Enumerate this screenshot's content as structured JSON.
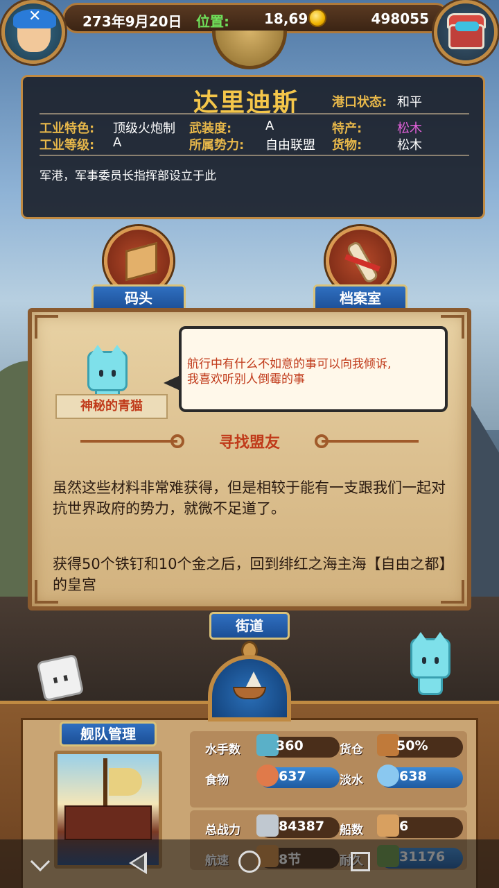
{
  "topbar": {
    "date": "273年9月20日",
    "position_label": "位置:",
    "position_value": "18,69",
    "gold": "498055"
  },
  "port": {
    "name": "达里迪斯",
    "status_label": "港口状态:",
    "status_value": "和平",
    "industry_feature_label": "工业特色:",
    "industry_feature_value": "顶级火炮制",
    "armament_label": "武装度:",
    "armament_value": "A",
    "specialty_label": "特产:",
    "specialty_value": "松木",
    "industry_level_label": "工业等级:",
    "industry_level_value": "A",
    "faction_label": "所属势力:",
    "faction_value": "自由联盟",
    "cargo_label": "货物:",
    "cargo_value": "松木",
    "description": "军港，军事委员长指挥部设立于此"
  },
  "buildings": {
    "dock": "码头",
    "archive": "档案室",
    "street": "街道"
  },
  "dialog": {
    "npc_name": "神秘的青猫",
    "bubble_line1": "航行中有什么不如意的事可以向我倾诉,",
    "bubble_line2": "我喜欢听别人倒霉的事",
    "quest_title": "寻找盟友",
    "quest_body": "虽然这些材料非常难获得，但是相较于能有一支跟我们一起对抗世界政府的势力，就微不足道了。",
    "quest_goal": "获得50个铁钉和10个金之后，回到绯红之海主海【自由之都】的皇宫"
  },
  "fleet": {
    "button_label": "舰队管理",
    "sailors_label": "水手数",
    "sailors_value": "360",
    "cargo_label": "货仓",
    "cargo_value": "50%",
    "food_label": "食物",
    "food_value": "637",
    "water_label": "淡水",
    "water_value": "638",
    "power_label": "总战力",
    "power_value": "84387",
    "ships_label": "船数",
    "ships_value": "6",
    "speed_label": "航速",
    "speed_value": "8节",
    "durability_label": "耐久",
    "durability_value": "31176"
  },
  "colors": {
    "accent_gold": "#f4c64a",
    "label_gold": "#e8b84a",
    "position_green": "#6fe05a",
    "specialty_pink": "#e060d8",
    "dialog_red": "#c03a1a",
    "ribbon_blue": "#2f6fc0"
  },
  "icons": {
    "avatar": "pirate-avatar-icon",
    "chest": "treasure-chest-icon",
    "coin": "gold-coin-icon",
    "dock": "dock-pier-icon",
    "archive": "scroll-icon",
    "helm": "ship-helm-icon"
  }
}
